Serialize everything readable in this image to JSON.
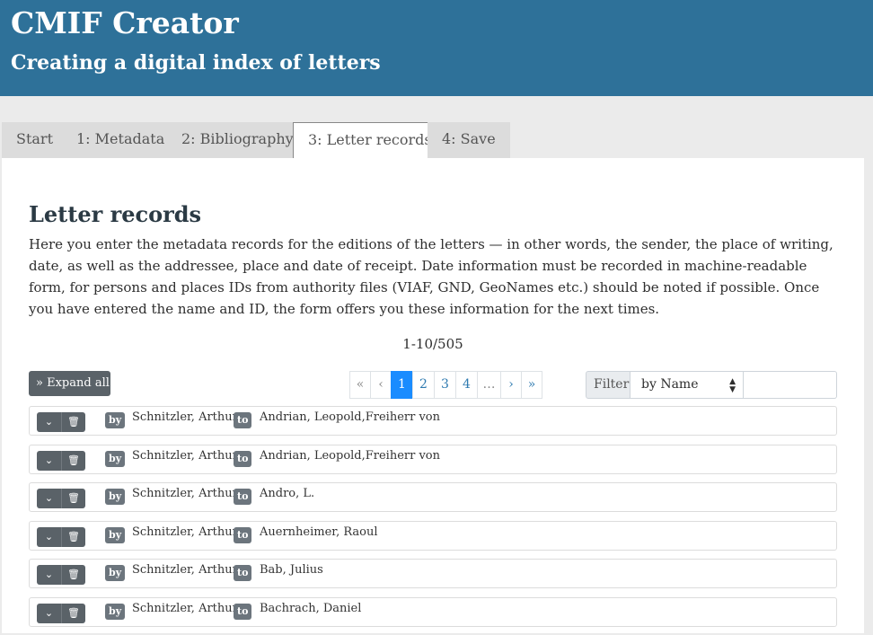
{
  "app": {
    "title": "CMIF Creator",
    "subtitle": "Creating a digital index of letters"
  },
  "tabs": [
    {
      "label": "Start",
      "active": false
    },
    {
      "label": "1: Metadata",
      "active": false
    },
    {
      "label": "2: Bibliography",
      "active": false
    },
    {
      "label": "3: Letter records",
      "active": true
    },
    {
      "label": "4: Save",
      "active": false
    }
  ],
  "main": {
    "heading": "Letter records",
    "description": "Here you enter the metadata records for the editions of the letters — in other words, the sender, the place of writing, date, as well as the addressee, place and date of receipt. Date information must be recorded in machine-readable form, for persons and places IDs from authority files (VIAF, GND, GeoNames etc.) should be noted if possible. Once you have entered the name and ID, the form offers you these information for the next times.",
    "range": "1-10/505",
    "expand_label": "Expand all",
    "expand_icon": "double-chevron-right-icon"
  },
  "pagination": {
    "first": "«",
    "prev": "‹",
    "pages": [
      "1",
      "2",
      "3",
      "4"
    ],
    "current": "1",
    "ellipsis": "…",
    "next": "›",
    "last": "»"
  },
  "filter": {
    "label": "Filter",
    "selected": "by Name",
    "value": ""
  },
  "records": [
    {
      "by_label": "by",
      "sender": "Schnitzler, Arthur",
      "to_label": "to",
      "recipient": "Andrian, Leopold,Freiherr von"
    },
    {
      "by_label": "by",
      "sender": "Schnitzler, Arthur",
      "to_label": "to",
      "recipient": "Andrian, Leopold,Freiherr von"
    },
    {
      "by_label": "by",
      "sender": "Schnitzler, Arthur",
      "to_label": "to",
      "recipient": "Andro, L."
    },
    {
      "by_label": "by",
      "sender": "Schnitzler, Arthur",
      "to_label": "to",
      "recipient": "Auernheimer, Raoul"
    },
    {
      "by_label": "by",
      "sender": "Schnitzler, Arthur",
      "to_label": "to",
      "recipient": "Bab, Julius"
    },
    {
      "by_label": "by",
      "sender": "Schnitzler, Arthur",
      "to_label": "to",
      "recipient": "Bachrach, Daniel"
    }
  ],
  "colors": {
    "header_bg": "#2e7199",
    "accent": "#1a8cff",
    "button_gray": "#5a6268"
  }
}
